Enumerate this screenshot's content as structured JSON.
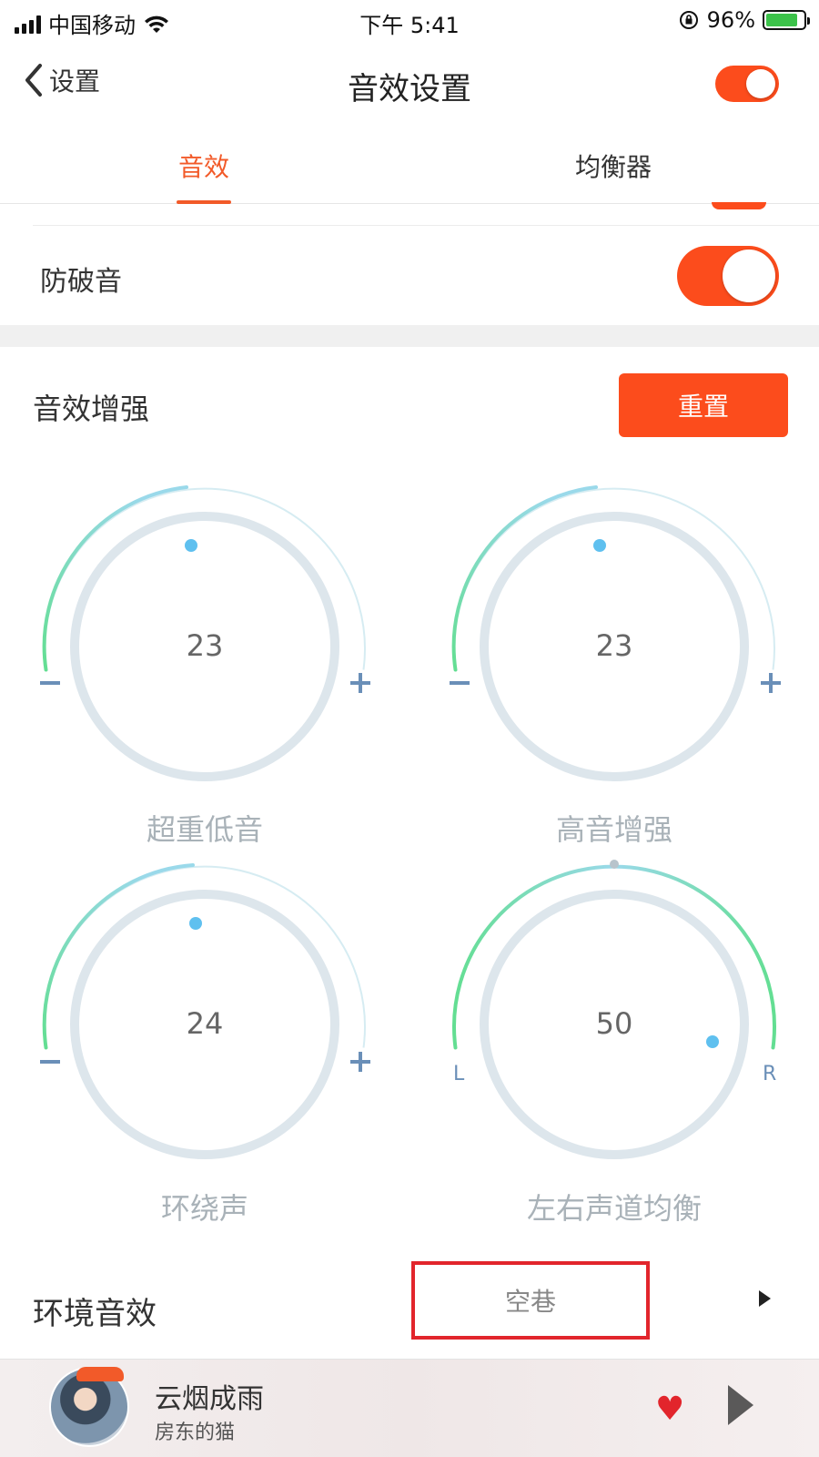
{
  "status_bar": {
    "carrier": "中国移动",
    "time": "下午 5:41",
    "battery": "96%"
  },
  "nav": {
    "back_label": "设置",
    "title": "音效设置",
    "master_toggle_on": true
  },
  "tabs": [
    {
      "label": "音效",
      "active": true
    },
    {
      "label": "均衡器",
      "active": false
    }
  ],
  "anti_pop": {
    "label": "防破音",
    "on": true
  },
  "enhance": {
    "title": "音效增强",
    "reset_label": "重置",
    "knobs": [
      {
        "label": "超重低音",
        "value": "23",
        "min_label": "−",
        "max_label": "+"
      },
      {
        "label": "高音增强",
        "value": "23",
        "min_label": "−",
        "max_label": "+"
      },
      {
        "label": "环绕声",
        "value": "24",
        "min_label": "−",
        "max_label": "+"
      },
      {
        "label": "左右声道均衡",
        "value": "50",
        "min_label": "L",
        "max_label": "R"
      }
    ]
  },
  "environment": {
    "label": "环境音效",
    "value": "空巷"
  },
  "player": {
    "song": "云烟成雨",
    "artist": "房东的猫"
  },
  "colors": {
    "accent": "#fc4c1c",
    "tab_active": "#f25a29",
    "dial_ring": "#dde6ec",
    "dial_dot": "#5fc0ef",
    "arc_start": "#63de92",
    "arc_end": "#9ad9ea"
  }
}
